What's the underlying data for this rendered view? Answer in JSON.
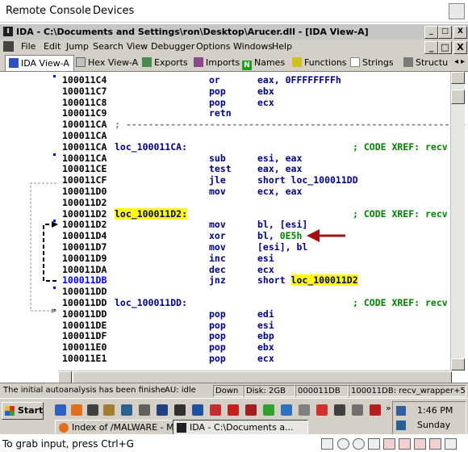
{
  "remote_console": {
    "menu": [
      "Remote Console",
      "Devices"
    ],
    "bottom_hint": "To grab input, press Ctrl+G"
  },
  "window": {
    "title": "IDA - C:\\Documents and Settings\\ron\\Desktop\\Arucer.dll - [IDA View-A]",
    "controls": [
      "_",
      "□",
      "X"
    ],
    "inner_controls": [
      "_",
      "□",
      "X"
    ]
  },
  "menu": [
    "File",
    "Edit",
    "Jump",
    "Search",
    "View",
    "Debugger",
    "Options",
    "Windows",
    "Help"
  ],
  "tabs": [
    {
      "label": "IDA View-A",
      "active": true
    },
    {
      "label": "Hex View-A",
      "active": false
    },
    {
      "label": "Exports",
      "active": false
    },
    {
      "label": "Imports",
      "active": false
    },
    {
      "label": "Names",
      "active": false
    },
    {
      "label": "Functions",
      "active": false
    },
    {
      "label": "Strings",
      "active": false
    },
    {
      "label": "Structu",
      "active": false
    }
  ],
  "listing": [
    {
      "addr": "100011C4",
      "mnem": "or",
      "ops": "eax, 0FFFFFFFFh"
    },
    {
      "addr": "100011C7",
      "mnem": "pop",
      "ops": "ebx"
    },
    {
      "addr": "100011C8",
      "mnem": "pop",
      "ops": "ecx"
    },
    {
      "addr": "100011C9",
      "mnem": "retn",
      "ops": ""
    },
    {
      "addr": "100011CA",
      "sep": "; ---------------------------------------------------------------"
    },
    {
      "addr": "100011CA"
    },
    {
      "addr": "100011CA",
      "label": "loc_100011CA:",
      "comment": "; CODE XREF: recv"
    },
    {
      "addr": "100011CA",
      "mnem": "sub",
      "ops": "esi, eax"
    },
    {
      "addr": "100011CE",
      "mnem": "test",
      "ops": "eax, eax"
    },
    {
      "addr": "100011CF",
      "mnem": "jle",
      "ops": "short loc_100011DD"
    },
    {
      "addr": "100011D0",
      "mnem": "mov",
      "ops": "ecx, eax"
    },
    {
      "addr": "100011D2"
    },
    {
      "addr": "100011D2",
      "label": "loc_100011D2:",
      "label_hl": true,
      "comment": "; CODE XREF: recv"
    },
    {
      "addr": "100011D2",
      "mnem": "mov",
      "ops": "bl, [esi]"
    },
    {
      "addr": "100011D4",
      "mnem": "xor",
      "ops_pre": "bl, ",
      "ops_num": "0E5h"
    },
    {
      "addr": "100011D7",
      "mnem": "mov",
      "ops": "[esi], bl"
    },
    {
      "addr": "100011D9",
      "mnem": "inc",
      "ops": "esi"
    },
    {
      "addr": "100011DA",
      "mnem": "dec",
      "ops": "ecx"
    },
    {
      "addr": "100011DB",
      "mnem": "jnz",
      "ops_pre": "short ",
      "ops_hl": "loc_100011D2",
      "current": true
    },
    {
      "addr": "100011DD"
    },
    {
      "addr": "100011DD",
      "label": "loc_100011DD:",
      "comment": "; CODE XREF: recv"
    },
    {
      "addr": "100011DD",
      "mnem": "pop",
      "ops": "edi"
    },
    {
      "addr": "100011DE",
      "mnem": "pop",
      "ops": "esi"
    },
    {
      "addr": "100011DF",
      "mnem": "pop",
      "ops": "ebp"
    },
    {
      "addr": "100011E0",
      "mnem": "pop",
      "ops": "ebx"
    },
    {
      "addr": "100011E1",
      "mnem": "pop",
      "ops": "ecx"
    }
  ],
  "status": {
    "message": "The initial autoanalysis has been finished.",
    "au": "AU:  idle",
    "direction": "Down",
    "disk": "Disk: 2GB",
    "offset": "000011DB",
    "location": "100011DB: recv_wrapper+5"
  },
  "taskbar": {
    "start": "Start",
    "tasks": [
      {
        "label": "Index of /MALWARE - M...",
        "active": false
      },
      {
        "label": "IDA - C:\\Documents a...",
        "active": true
      }
    ],
    "clock": "1:46 PM",
    "day": "Sunday"
  },
  "colors": {
    "accent_arrow": "#a01010",
    "highlight": "#ffff00",
    "comment": "#008000",
    "code": "#000080"
  }
}
